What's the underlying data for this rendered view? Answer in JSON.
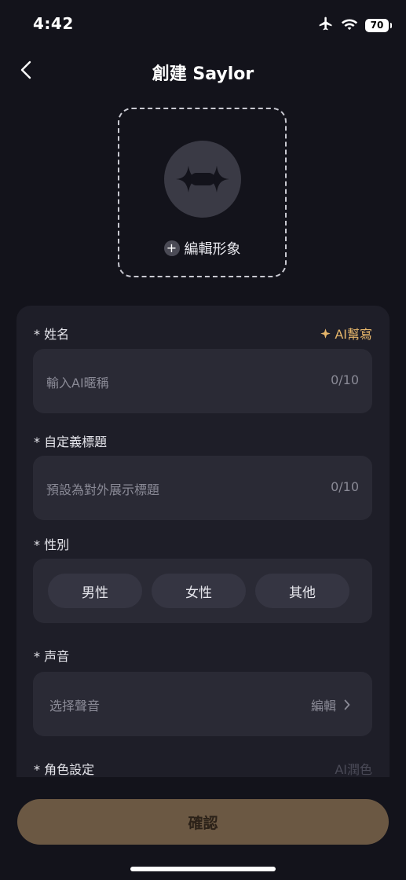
{
  "status_bar": {
    "time": "4:42",
    "battery": "70"
  },
  "header": {
    "title": "創建 Saylor"
  },
  "avatar": {
    "edit_label": "編輯形象"
  },
  "form": {
    "name": {
      "label": "* 姓名",
      "ai_label": "AI幫寫",
      "placeholder": "輸入AI暱稱",
      "counter": "0/10"
    },
    "title_field": {
      "label": "* 自定義標題",
      "placeholder": "預設為對外展示標題",
      "counter": "0/10"
    },
    "gender": {
      "label": "* 性別",
      "options": [
        "男性",
        "女性",
        "其他"
      ]
    },
    "voice": {
      "label": "* 声音",
      "placeholder": "选择聲音",
      "edit_label": "編輯"
    },
    "role": {
      "label": "* 角色設定",
      "ai_label": "AI潤色"
    }
  },
  "confirm_label": "確認"
}
